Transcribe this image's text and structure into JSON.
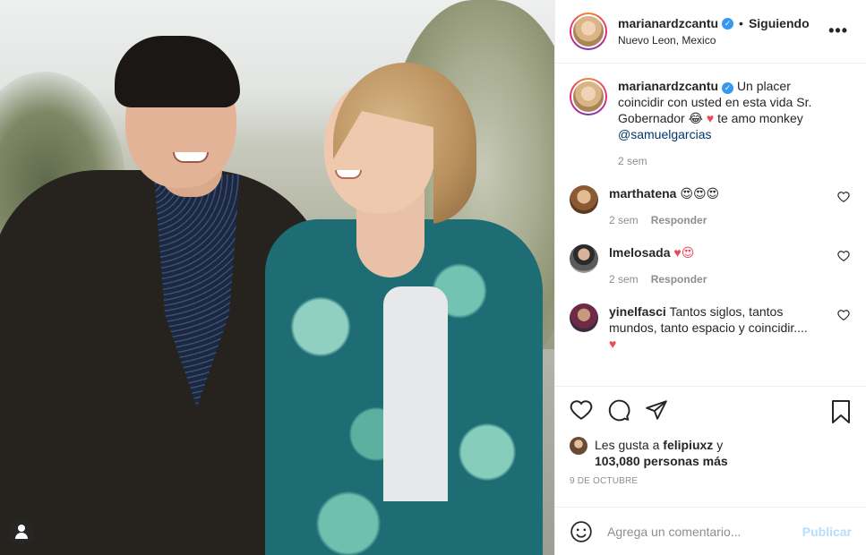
{
  "header": {
    "username": "marianardzcantu",
    "verified_glyph": "✓",
    "separator": "•",
    "follow_label": "Siguiendo",
    "location": "Nuevo Leon, Mexico",
    "more_glyph": "•••"
  },
  "caption": {
    "username": "marianardzcantu",
    "text_part1": "Un placer coincidir con usted en esta vida Sr. Gobernador 😂",
    "heart": "♥",
    "text_part2": "te amo monkey",
    "mention": "@samuelgarcias",
    "time": "2 sem"
  },
  "comments": [
    {
      "username": "marthatena",
      "text": "😍😍😍",
      "time": "2 sem",
      "reply": "Responder"
    },
    {
      "username": "lmelosada",
      "text": "♥😍",
      "time": "2 sem",
      "reply": "Responder"
    },
    {
      "username": "yinelfasci",
      "text": "Tantos siglos, tantos mundos, tanto espacio y coincidir....",
      "text2": "♥"
    }
  ],
  "likes": {
    "prefix": "Les gusta a",
    "user": "felipiuxz",
    "conj": "y",
    "count_text": "103,080 personas más"
  },
  "date": "9 de octubre",
  "add_comment": {
    "placeholder": "Agrega un comentario...",
    "publish_label": "Publicar"
  },
  "icons": {
    "header": [
      "verified-icon",
      "more-icon"
    ],
    "actions": [
      "heart-icon",
      "comment-icon",
      "share-icon",
      "bookmark-icon"
    ],
    "composer": [
      "emoji-icon"
    ],
    "photo": [
      "tag-user-icon"
    ]
  },
  "colors": {
    "verified": "#3897f0",
    "mention": "#00376b",
    "heart": "#ed4956",
    "publish_disabled": "#b2dffc",
    "meta_text": "#8e8e8e"
  }
}
